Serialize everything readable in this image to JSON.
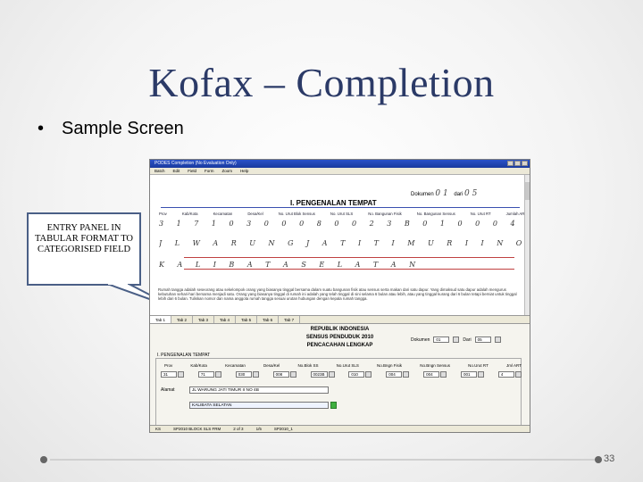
{
  "slide": {
    "title": "Kofax – Completion",
    "bullet": "Sample Screen",
    "callout": "ENTRY PANEL IN TABULAR FORMAT TO CATEGORISED FIELD",
    "page_number": "33"
  },
  "window": {
    "title": "PODES Completion (No Evaluation Only)",
    "menu": [
      "Batch",
      "Edit",
      "Field",
      "Form",
      "Zoom",
      "Help"
    ]
  },
  "top_pane": {
    "dokumen_label": "Dokumen",
    "dokumen_value": "0 1",
    "dari_label": "dari",
    "dari_value": "0 5",
    "section_title": "I. PENGENALAN TEMPAT",
    "column_headers": [
      "Prov",
      "Kab/Kota",
      "Kecamatan",
      "Desa/Kel",
      "No. Urut Blok Sensus",
      "No. Urut SLS",
      "No. Bangunan Fisik",
      "No. Bangunan Sensus",
      "No. Urut RT",
      "Jumlah ART"
    ],
    "hw_codes": "3 1   7 1   0 3 0   0 0 8   0 0 2 3 B   0 1 0   0 0 4   0 0 4   0 0 1   4",
    "hw_street": "J L   W A R U N G   J A T I   T I M U R   I I   N O   4 B",
    "hw_area": "K A L I B A T A   S E L A T A N",
    "instructions": "Rumah tangga adalah seseorang atau sekelompok orang yang biasanya tinggal bersama dalam suatu bangunan fisik atau sensus serta makan dari satu dapur. Yang dimaksud satu dapur adalah mengurus kebutuhan sehari-hari bersama menjadi satu. Orang yang biasanya tinggal di rumah ini adalah yang telah tinggal di sini selama 6 bulan atau lebih, atau yang tinggal kurang dari 6 bulan tetapi berniat untuk tinggal lebih dari 6 bulan. Tuliskan nomor dan nama anggota rumah tangga sesuai urutan hubungan dengan kepala rumah tangga."
  },
  "tabs": [
    "Tab 1",
    "Tab 2",
    "Tab 3",
    "Tab 4",
    "Tab 5",
    "Tab 6",
    "Tab 7"
  ],
  "bottom_pane": {
    "header1": "REPUBLIK INDONESIA",
    "header2": "SENSUS PENDUDUK 2010",
    "header3": "PENCACAHAN LENGKAP",
    "dokumen_label": "Dokumen",
    "dokumen_value": "01",
    "dari_label": "Dari",
    "dari_value": "05",
    "group_label": "I. PENGENALAN TEMPAT",
    "field_headers": [
      "Prov",
      "Kab/Kota",
      "Kecamatan",
      "Desa/Kel",
      "No.Blok SS",
      "No.Urut SLS",
      "No.Bngn Fisik",
      "No.Bngn Sensus",
      "No.Urut RT",
      "Jml ART"
    ],
    "field_values": [
      "31",
      "71",
      "030",
      "008",
      "0023B",
      "010",
      "004",
      "004",
      "001",
      "4"
    ],
    "alamat_label": "Alamat",
    "alamat_line1": "JL WARUNG JATI TIMUR II NO 4B",
    "alamat_line2": "KALIBATA SELATAN"
  },
  "statusbar": [
    "KS",
    "SP2010 BLOCK SLS FRM",
    "2 of 3",
    "1/5",
    "SP2010_1"
  ],
  "colors": {
    "title": "#2b3a67",
    "titlebar": "#2a52c9",
    "callout_border": "#4a5f86",
    "accept_button": "#3fb03f"
  }
}
